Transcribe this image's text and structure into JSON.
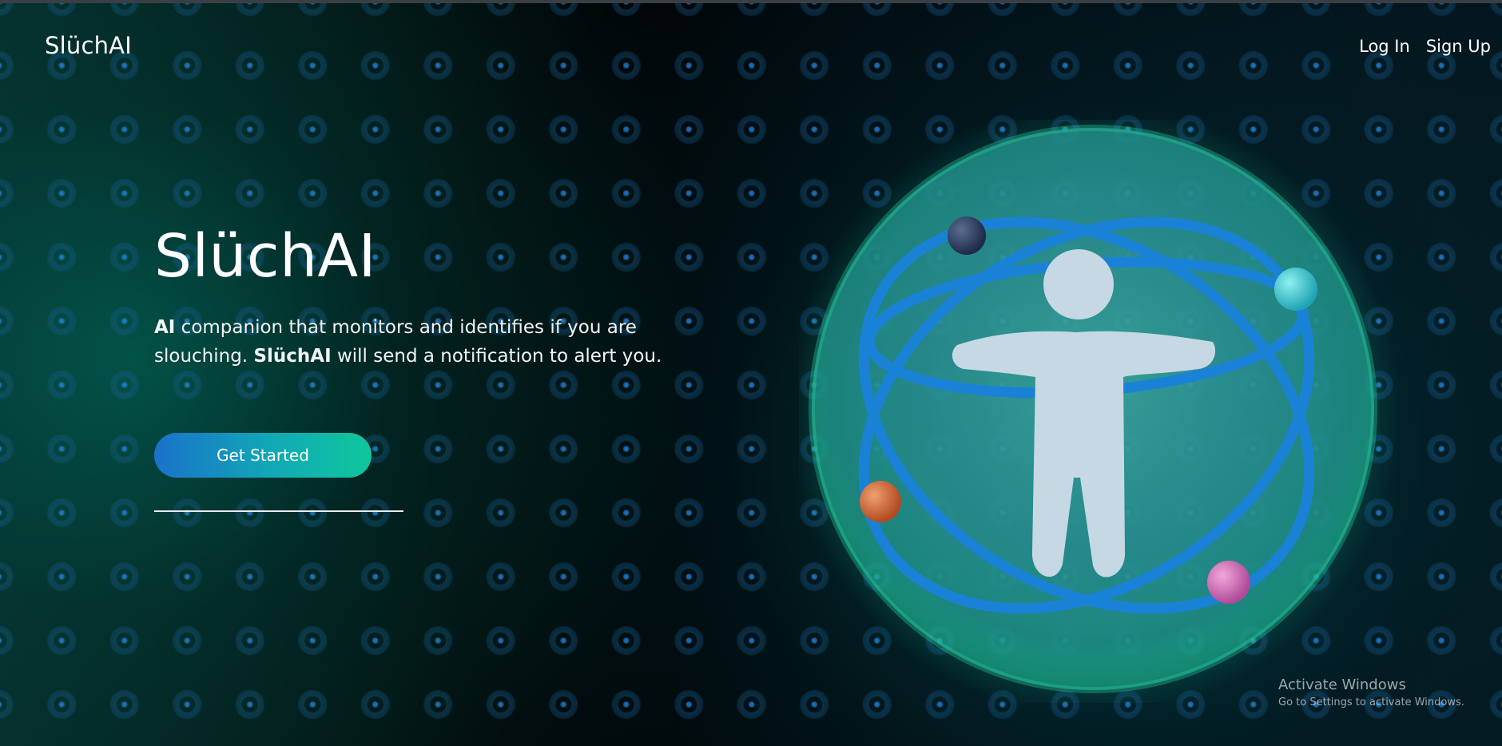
{
  "nav": {
    "brand": "SlüchAI",
    "login_label": "Log In",
    "signup_label": "Sign Up"
  },
  "hero": {
    "title": "SlüchAI",
    "description": {
      "bold_1": "AI",
      "text_1": " companion that monitors and identifies if you are slouching. ",
      "bold_2": "SlüchAI",
      "text_2": " will send a notification to alert you."
    },
    "cta_label": "Get Started"
  },
  "icons": {
    "hero_illustration": "posture-atom-icon"
  },
  "colors": {
    "button_gradient_start": "#1a72c9",
    "button_gradient_end": "#0fc79b",
    "sphere": "#1fa89a",
    "orbit": "#1a82d6",
    "figure": "#c6d8e3"
  },
  "watermark": {
    "line1": "Activate Windows",
    "line2": "Go to Settings to activate Windows."
  }
}
